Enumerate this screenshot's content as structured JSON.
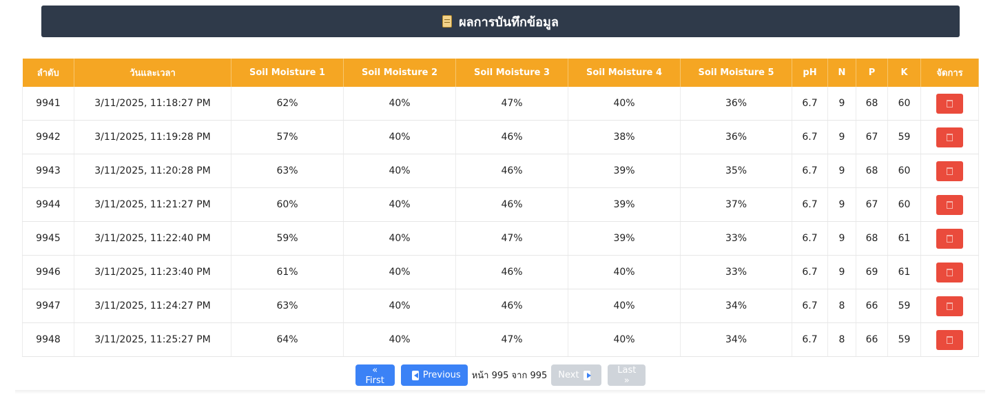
{
  "header": {
    "title": "ผลการบันทึกข้อมูล",
    "icon": "memo-icon"
  },
  "table": {
    "columns": [
      "ลำดับ",
      "วันและเวลา",
      "Soil Moisture 1",
      "Soil Moisture 2",
      "Soil Moisture 3",
      "Soil Moisture 4",
      "Soil Moisture 5",
      "pH",
      "N",
      "P",
      "K",
      "จัดการ"
    ],
    "rows": [
      [
        "9941",
        "3/11/2025, 11:18:27 PM",
        "62%",
        "40%",
        "47%",
        "40%",
        "36%",
        "6.7",
        "9",
        "68",
        "60"
      ],
      [
        "9942",
        "3/11/2025, 11:19:28 PM",
        "57%",
        "40%",
        "46%",
        "38%",
        "36%",
        "6.7",
        "9",
        "67",
        "59"
      ],
      [
        "9943",
        "3/11/2025, 11:20:28 PM",
        "63%",
        "40%",
        "46%",
        "39%",
        "35%",
        "6.7",
        "9",
        "68",
        "60"
      ],
      [
        "9944",
        "3/11/2025, 11:21:27 PM",
        "60%",
        "40%",
        "46%",
        "39%",
        "37%",
        "6.7",
        "9",
        "67",
        "60"
      ],
      [
        "9945",
        "3/11/2025, 11:22:40 PM",
        "59%",
        "40%",
        "47%",
        "39%",
        "33%",
        "6.7",
        "9",
        "68",
        "61"
      ],
      [
        "9946",
        "3/11/2025, 11:23:40 PM",
        "61%",
        "40%",
        "46%",
        "40%",
        "33%",
        "6.7",
        "9",
        "69",
        "61"
      ],
      [
        "9947",
        "3/11/2025, 11:24:27 PM",
        "63%",
        "40%",
        "46%",
        "40%",
        "34%",
        "6.7",
        "8",
        "66",
        "59"
      ],
      [
        "9948",
        "3/11/2025, 11:25:27 PM",
        "64%",
        "40%",
        "47%",
        "40%",
        "34%",
        "6.7",
        "8",
        "66",
        "59"
      ]
    ]
  },
  "pagination": {
    "first_label": "« First",
    "previous_label": "Previous",
    "page_info": "หน้า 995 จาก 995",
    "next_label": "Next",
    "last_label": "Last »"
  },
  "colors": {
    "header_bar": "#2f3a4a",
    "table_header": "#f5a623",
    "delete_button": "#ea4b3c",
    "active_button": "#3b82f6",
    "disabled_button": "#cfd4da"
  }
}
